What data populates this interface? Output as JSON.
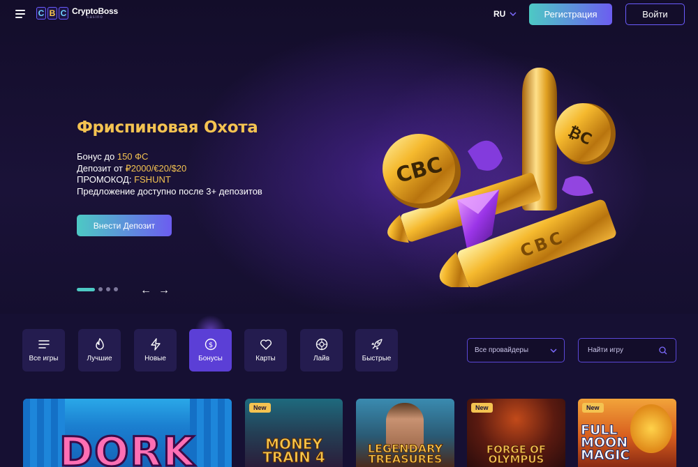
{
  "header": {
    "logo_letters": [
      "C",
      "B",
      "C"
    ],
    "logo_name": "CryptoBoss",
    "logo_sub": "casino",
    "language": "RU",
    "register_label": "Регистрация",
    "login_label": "Войти"
  },
  "hero": {
    "title": "Фриспиновая Охота",
    "line1_prefix": "Бонус до ",
    "line1_value": "150 ФС",
    "line2_prefix": "Депозит от ",
    "line2_value": "₽2000/€20/$20",
    "line3_prefix": "ПРОМОКОД: ",
    "line3_value": "FSHUNT",
    "line4": "Предложение доступно после 3+ депозитов",
    "deposit_label": "Внести Депозит",
    "slide_current": 1,
    "slide_count": 4,
    "prev_arrow": "←",
    "next_arrow": "→",
    "art_logo": "CBC"
  },
  "categories": [
    {
      "label": "Все игры",
      "icon": "list-icon",
      "active": false
    },
    {
      "label": "Лучшие",
      "icon": "flame-icon",
      "active": false
    },
    {
      "label": "Новые",
      "icon": "lightning-icon",
      "active": false
    },
    {
      "label": "Бонусы",
      "icon": "dollar-coin-icon",
      "active": true
    },
    {
      "label": "Карты",
      "icon": "heart-icon",
      "active": false
    },
    {
      "label": "Лайв",
      "icon": "roulette-icon",
      "active": false
    },
    {
      "label": "Быстрые",
      "icon": "rocket-icon",
      "active": false
    }
  ],
  "filters": {
    "provider_value": "Все провайдеры",
    "search_placeholder": "Найти игру"
  },
  "games": [
    {
      "title": "DORK",
      "new": false
    },
    {
      "title": "MONEY TRAIN 4",
      "new": true,
      "badge": "New"
    },
    {
      "title": "LEGENDARY TREASURES",
      "new": false
    },
    {
      "title": "FORGE OF OLYMPUS",
      "new": true,
      "badge": "New"
    },
    {
      "title": "FULL MOON MAGIC",
      "new": true,
      "badge": "New"
    }
  ],
  "colors": {
    "accent_gold": "#f4c351",
    "accent_teal": "#4dc9c4",
    "accent_purple": "#6c5df0",
    "background": "#140f2e"
  }
}
